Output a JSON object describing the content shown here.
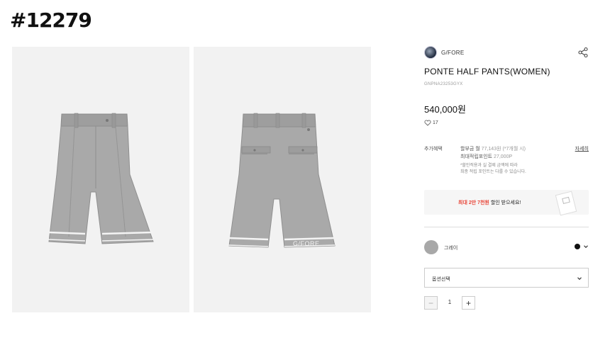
{
  "ticket_id": "#12279",
  "gallery": {
    "front_alt": "front view",
    "back_alt": "back view",
    "back_logo": "G/FORE",
    "fabric_color": "#a9a9a9",
    "stripe_color": "#f4f4f4"
  },
  "product": {
    "brand": "G/FORE",
    "name": "PONTE HALF PANTS(WOMEN)",
    "code": "GNPNA23253GYX",
    "price": "540,000원",
    "likes": "17"
  },
  "benefit": {
    "label": "추가혜택",
    "installment_prefix": "할부금 월",
    "installment_value": "77,143원 (*7개월 시)",
    "points_prefix": "최대적립포인트",
    "points_value": "27,000P",
    "note_line1": "*할인적용과 실 결제 금액에 따라",
    "note_line2": "최종 적립 포인트는 다를 수 있습니다.",
    "detail_link": "자세히"
  },
  "coupon": {
    "highlight": "최대 2만 7천원",
    "suffix": " 할인 받으세요!"
  },
  "color": {
    "label": "그레이",
    "swatch": "#a8a8a8",
    "selected": "#111111"
  },
  "option": {
    "placeholder": "옵션선택"
  },
  "quantity": {
    "value": "1",
    "minus": "−",
    "plus": "+"
  }
}
